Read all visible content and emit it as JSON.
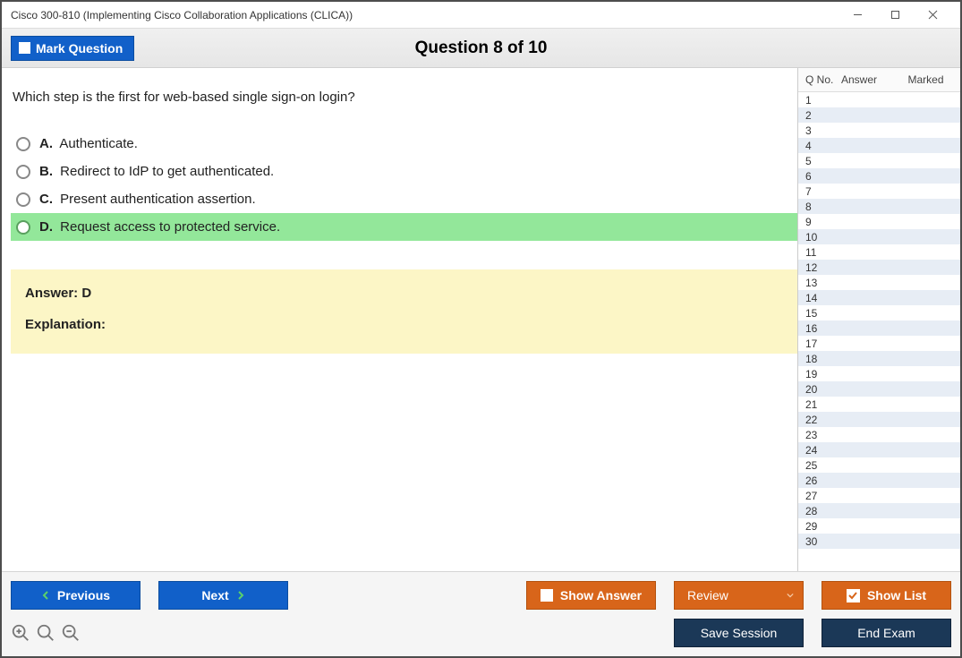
{
  "window": {
    "title": "Cisco 300-810 (Implementing Cisco Collaboration Applications (CLICA))"
  },
  "header": {
    "mark_label": "Mark Question",
    "question_label": "Question 8 of 10"
  },
  "question": {
    "text": "Which step is the first for web-based single sign-on login?",
    "options": [
      {
        "letter": "A.",
        "text": "Authenticate.",
        "selected": false
      },
      {
        "letter": "B.",
        "text": "Redirect to IdP to get authenticated.",
        "selected": false
      },
      {
        "letter": "C.",
        "text": "Present authentication assertion.",
        "selected": false
      },
      {
        "letter": "D.",
        "text": "Request access to protected service.",
        "selected": true
      }
    ]
  },
  "answer": {
    "line": "Answer: D",
    "explanation_label": "Explanation:"
  },
  "sidebar": {
    "head": {
      "qno": "Q No.",
      "answer": "Answer",
      "marked": "Marked"
    },
    "rows": [
      1,
      2,
      3,
      4,
      5,
      6,
      7,
      8,
      9,
      10,
      11,
      12,
      13,
      14,
      15,
      16,
      17,
      18,
      19,
      20,
      21,
      22,
      23,
      24,
      25,
      26,
      27,
      28,
      29,
      30
    ]
  },
  "footer": {
    "previous": "Previous",
    "next": "Next",
    "show_answer": "Show Answer",
    "review": "Review",
    "show_list": "Show List",
    "save_session": "Save Session",
    "end_exam": "End Exam"
  }
}
